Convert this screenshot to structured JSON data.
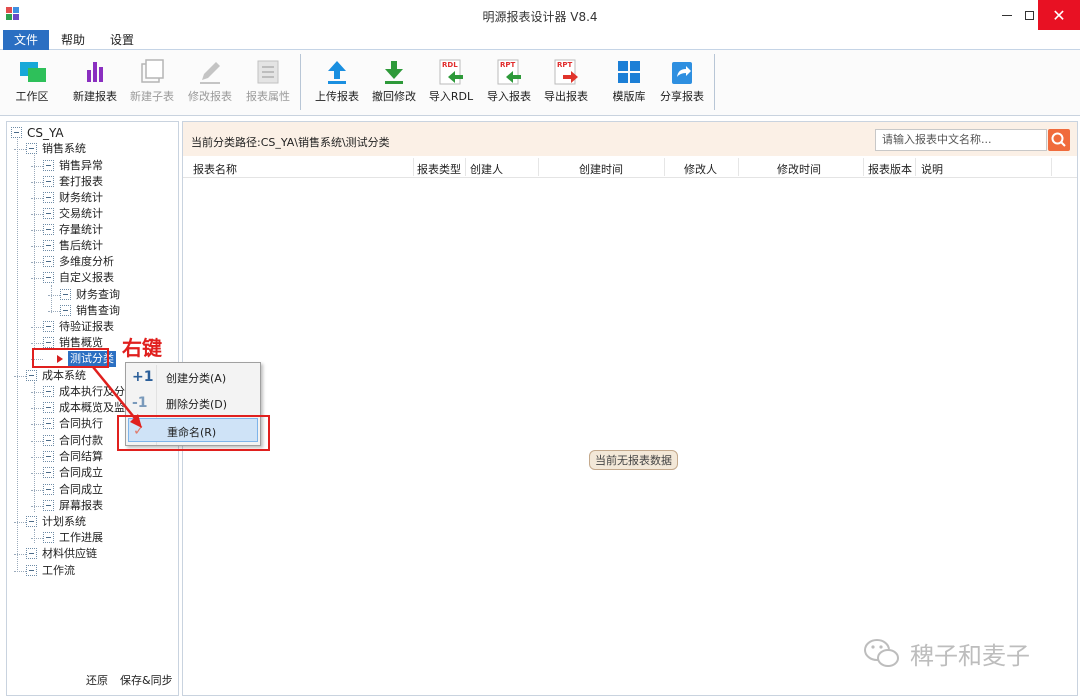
{
  "window": {
    "title": "明源报表设计器 V8.4"
  },
  "menu": {
    "tabs": [
      "文件",
      "帮助",
      "设置"
    ]
  },
  "ribbon": {
    "buttons": [
      {
        "label": "工作区",
        "icon": "workspace-icon",
        "enabled": true
      },
      {
        "label": "新建报表",
        "icon": "bar-chart-icon",
        "enabled": true
      },
      {
        "label": "新建子表",
        "icon": "subtable-icon",
        "enabled": false
      },
      {
        "label": "修改报表",
        "icon": "pencil-icon",
        "enabled": false
      },
      {
        "label": "报表属性",
        "icon": "properties-icon",
        "enabled": false
      },
      {
        "label": "上传报表",
        "icon": "upload-icon",
        "enabled": true
      },
      {
        "label": "撤回修改",
        "icon": "download-icon",
        "enabled": true
      },
      {
        "label": "导入RDL",
        "icon": "import-rdl-icon",
        "enabled": true
      },
      {
        "label": "导入报表",
        "icon": "import-rpt-icon",
        "enabled": true
      },
      {
        "label": "导出报表",
        "icon": "export-rpt-icon",
        "enabled": true
      },
      {
        "label": "模版库",
        "icon": "template-library-icon",
        "enabled": true
      },
      {
        "label": "分享报表",
        "icon": "share-icon",
        "enabled": true
      }
    ],
    "icon_badges": {
      "rdl": "RDL",
      "rpt": "RPT"
    }
  },
  "tree": {
    "root": "CS_YA",
    "nodes": [
      {
        "label": "销售系统"
      },
      {
        "label": "销售异常"
      },
      {
        "label": "套打报表"
      },
      {
        "label": "财务统计"
      },
      {
        "label": "交易统计"
      },
      {
        "label": "存量统计"
      },
      {
        "label": "售后统计"
      },
      {
        "label": "多维度分析"
      },
      {
        "label": "自定义报表"
      },
      {
        "label": "财务查询"
      },
      {
        "label": "销售查询"
      },
      {
        "label": "待验证报表"
      },
      {
        "label": "销售概览"
      },
      {
        "label": "测试分类"
      },
      {
        "label": "成本系统"
      },
      {
        "label": "成本执行及分"
      },
      {
        "label": "成本概览及监"
      },
      {
        "label": "合同执行"
      },
      {
        "label": "合同付款"
      },
      {
        "label": "合同结算"
      },
      {
        "label": "合同成立"
      },
      {
        "label": "合同成立"
      },
      {
        "label": "屏幕报表"
      },
      {
        "label": "计划系统"
      },
      {
        "label": "工作进展"
      },
      {
        "label": "材料供应链"
      },
      {
        "label": "工作流"
      }
    ],
    "footer": {
      "restore": "还原",
      "save_sync": "保存&同步"
    }
  },
  "main": {
    "path": "当前分类路径:CS_YA\\销售系统\\测试分类",
    "search_placeholder": "请输入报表中文名称...",
    "columns": [
      "报表名称",
      "报表类型",
      "创建人",
      "创建时间",
      "修改人",
      "修改时间",
      "报表版本",
      "说明"
    ],
    "empty_message": "当前无报表数据"
  },
  "context_menu": {
    "items": [
      {
        "icon": "+1",
        "label": "创建分类(A)"
      },
      {
        "icon": "-1",
        "label": "删除分类(D)"
      },
      {
        "icon": "✓",
        "label": "重命名(R)"
      }
    ]
  },
  "annotation": {
    "text": "右键"
  },
  "watermark": {
    "text": "稗子和麦子"
  },
  "colors": {
    "accent": "#2b6fc2",
    "annotation": "#e0201e",
    "path_bar": "#fbf0e6",
    "search_button": "#f06b3c",
    "close_button": "#e81123"
  }
}
